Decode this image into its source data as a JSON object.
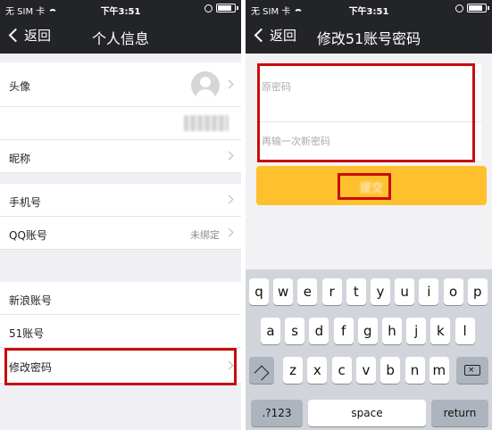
{
  "status_bar": {
    "carrier": "无 SIM 卡",
    "time": "下午3:51",
    "battery_level": 0.85
  },
  "left_screen": {
    "back_label": "返回",
    "title": "个人信息",
    "rows": {
      "avatar": "头像",
      "nickname": "昵称",
      "phone": "手机号",
      "qq": "QQ账号",
      "qq_value": "未绑定",
      "weibo": "新浪账号",
      "account51": "51账号",
      "change_password": "修改密码"
    }
  },
  "right_screen": {
    "back_label": "返回",
    "title": "修改51账号密码",
    "password_placeholder": "原密码",
    "confirm_placeholder": "再输一次新密码",
    "submit_label": "提交"
  },
  "keyboard": {
    "row1": [
      "q",
      "w",
      "e",
      "r",
      "t",
      "y",
      "u",
      "i",
      "o",
      "p"
    ],
    "row2": [
      "a",
      "s",
      "d",
      "f",
      "g",
      "h",
      "j",
      "k",
      "l"
    ],
    "row3": [
      "z",
      "x",
      "c",
      "v",
      "b",
      "n",
      "m"
    ],
    "numbers_label": ".?123",
    "space_label": "space",
    "return_label": "return"
  }
}
